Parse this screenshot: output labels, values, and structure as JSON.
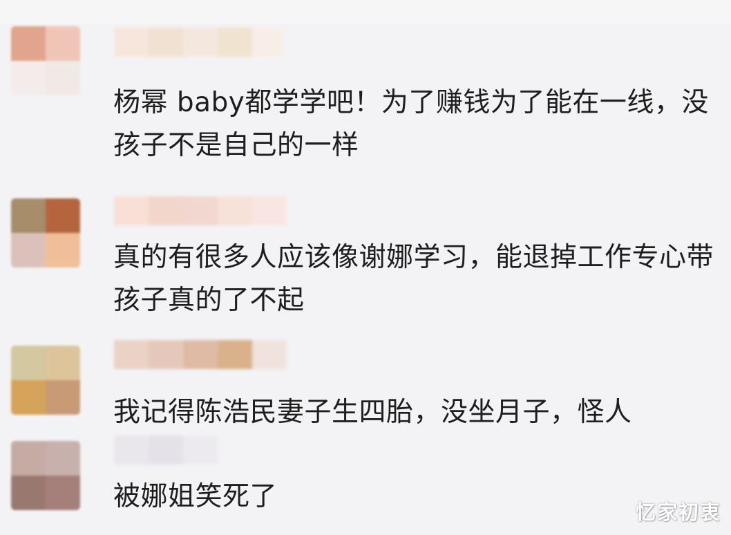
{
  "comments": [
    {
      "text": "杨幂 baby都学学吧！为了赚钱为了能在一线，没孩子不是自己的一样",
      "avatar_colors": [
        "#e1a48c",
        "#efc5b7",
        "#f4ecea",
        "#f1e9e5"
      ],
      "username_colors": [
        "#f6e6db",
        "#f1e1d3",
        "#f4e8de",
        "#f0e3cf",
        "#f8eee8"
      ]
    },
    {
      "text": "真的有很多人应该像谢娜学习，能退掉工作专心带孩子真的了不起",
      "avatar_colors": [
        "#a88d6b",
        "#b5653d",
        "#dcc1bb",
        "#f0bf99"
      ],
      "username_colors": [
        "#f8e0d6",
        "#f3d6cb",
        "#f1d7d0",
        "#f6e2d8",
        "#f9e6e2"
      ]
    },
    {
      "text": "我记得陈浩民妻子生四胎，没坐月子，怪人",
      "avatar_colors": [
        "#d3c8a0",
        "#ddc49b",
        "#d5a45a",
        "#c99a76"
      ],
      "username_colors": [
        "#ead2c5",
        "#e5c8bb",
        "#dfbba6",
        "#d9b18a",
        "#f0e3de"
      ]
    },
    {
      "text": "被娜姐笑死了",
      "avatar_colors": [
        "#c6aba5",
        "#c8b1ac",
        "#997870",
        "#a57f79"
      ],
      "username_colors": [
        "#e9e6ec",
        "#e4e2e8",
        "#eceaef"
      ]
    }
  ],
  "watermark": "忆家初衷"
}
